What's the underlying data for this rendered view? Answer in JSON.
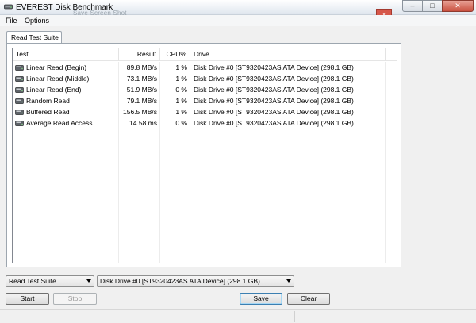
{
  "window": {
    "title": "EVEREST Disk Benchmark",
    "overlapping_dialog_title": "Save Screen Shot",
    "overlapping_dialog_close": "x",
    "minimize": "–",
    "maximize": "□",
    "close": "✕"
  },
  "menu": {
    "file": "File",
    "options": "Options"
  },
  "tab": {
    "label": "Read Test Suite"
  },
  "table": {
    "headers": {
      "test": "Test",
      "result": "Result",
      "cpu": "CPU%",
      "drive": "Drive"
    },
    "rows": [
      {
        "test": "Linear Read (Begin)",
        "result": "89.8 MB/s",
        "cpu": "1 %",
        "drive": "Disk Drive #0  [ST9320423AS ATA Device]  (298.1 GB)"
      },
      {
        "test": "Linear Read (Middle)",
        "result": "73.1 MB/s",
        "cpu": "1 %",
        "drive": "Disk Drive #0  [ST9320423AS ATA Device]  (298.1 GB)"
      },
      {
        "test": "Linear Read (End)",
        "result": "51.9 MB/s",
        "cpu": "0 %",
        "drive": "Disk Drive #0  [ST9320423AS ATA Device]  (298.1 GB)"
      },
      {
        "test": "Random Read",
        "result": "79.1 MB/s",
        "cpu": "1 %",
        "drive": "Disk Drive #0  [ST9320423AS ATA Device]  (298.1 GB)"
      },
      {
        "test": "Buffered Read",
        "result": "156.5 MB/s",
        "cpu": "1 %",
        "drive": "Disk Drive #0  [ST9320423AS ATA Device]  (298.1 GB)"
      },
      {
        "test": "Average Read Access",
        "result": "14.58 ms",
        "cpu": "0 %",
        "drive": "Disk Drive #0  [ST9320423AS ATA Device]  (298.1 GB)"
      }
    ]
  },
  "controls": {
    "suite_select": "Read Test Suite",
    "drive_select": "Disk Drive #0  [ST9320423AS ATA Device]  (298.1 GB)",
    "start": "Start",
    "stop": "Stop",
    "save": "Save",
    "clear": "Clear"
  },
  "icons": {
    "app": "disk-icon",
    "row": "hard-drive-icon",
    "dropdown": "chevron-down-icon"
  },
  "colors": {
    "title_gradient_bottom": "#dfe6ee",
    "close_button": "#c9503f",
    "default_button_border": "#3c7fb1"
  }
}
